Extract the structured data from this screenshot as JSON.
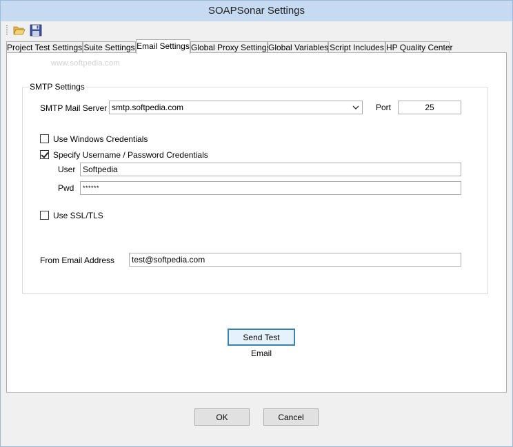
{
  "window": {
    "title": "SOAPSonar Settings"
  },
  "toolbar": {
    "open_icon": "folder-open-icon",
    "save_icon": "floppy-save-icon"
  },
  "tabs": [
    {
      "label": "Project Test Settings"
    },
    {
      "label": "Suite Settings"
    },
    {
      "label": "Email Settings",
      "active": true
    },
    {
      "label": "Global Proxy Settings"
    },
    {
      "label": "Global Variables"
    },
    {
      "label": "Script Includes"
    },
    {
      "label": "HP Quality Center"
    }
  ],
  "watermark": "www.softpedia.com",
  "smtp": {
    "group_label": "SMTP Settings",
    "server_label": "SMTP Mail Server",
    "server_value": "smtp.softpedia.com",
    "port_label": "Port",
    "port_value": "25",
    "windows_credentials_label": "Use Windows Credentials",
    "windows_credentials_checked": false,
    "specify_credentials_label": "Specify Username / Password Credentials",
    "specify_credentials_checked": true,
    "user_label": "User",
    "user_value": "Softpedia",
    "pwd_label": "Pwd",
    "pwd_value": "******",
    "ssl_label": "Use SSL/TLS",
    "ssl_checked": false,
    "from_label": "From Email Address",
    "from_value": "test@softpedia.com"
  },
  "buttons": {
    "send_test": "Send Test Email",
    "ok": "OK",
    "cancel": "Cancel"
  },
  "colors": {
    "titlebar": "#c6dbf2",
    "accent": "#3c7fb1"
  }
}
